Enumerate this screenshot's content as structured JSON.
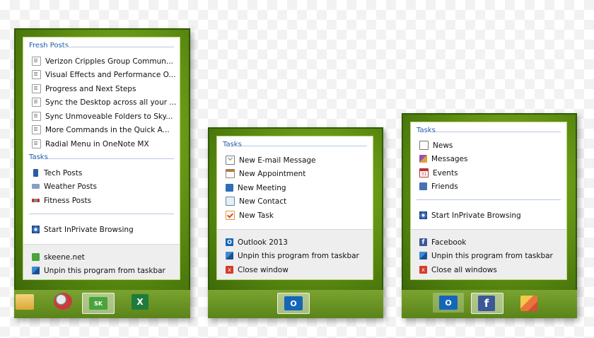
{
  "panel1": {
    "section_fresh": "Fresh Posts",
    "fresh_posts": [
      "Verizon Cripples Group Commun...",
      "Visual Effects and Performance O...",
      "Progress and Next Steps",
      "Sync the Desktop across all your ...",
      "Sync Unmoveable Folders to Sky...",
      "More Commands in the Quick A...",
      "Radial Menu in OneNote MX"
    ],
    "section_tasks": "Tasks",
    "tasks": [
      "Tech Posts",
      "Weather Posts",
      "Fitness Posts"
    ],
    "inprivate": "Start InPrivate Browsing",
    "footer": [
      "skeene.net",
      "Unpin this program from taskbar"
    ],
    "taskbar_sk": "SK",
    "taskbar_excel": "X"
  },
  "panel2": {
    "section_tasks": "Tasks",
    "tasks": [
      "New E-mail Message",
      "New Appointment",
      "New Meeting",
      "New Contact",
      "New Task"
    ],
    "footer": [
      "Outlook 2013",
      "Unpin this program from taskbar",
      "Close window"
    ],
    "outlook_glyph": "O",
    "close_glyph": "x"
  },
  "panel3": {
    "section_tasks": "Tasks",
    "tasks": [
      "News",
      "Messages",
      "Events",
      "Friends"
    ],
    "events_day": "31",
    "inprivate": "Start InPrivate Browsing",
    "footer": [
      "Facebook",
      "Unpin this program from taskbar",
      "Close all windows"
    ],
    "fb_glyph": "f",
    "close_glyph": "x",
    "outlook_glyph": "O"
  }
}
